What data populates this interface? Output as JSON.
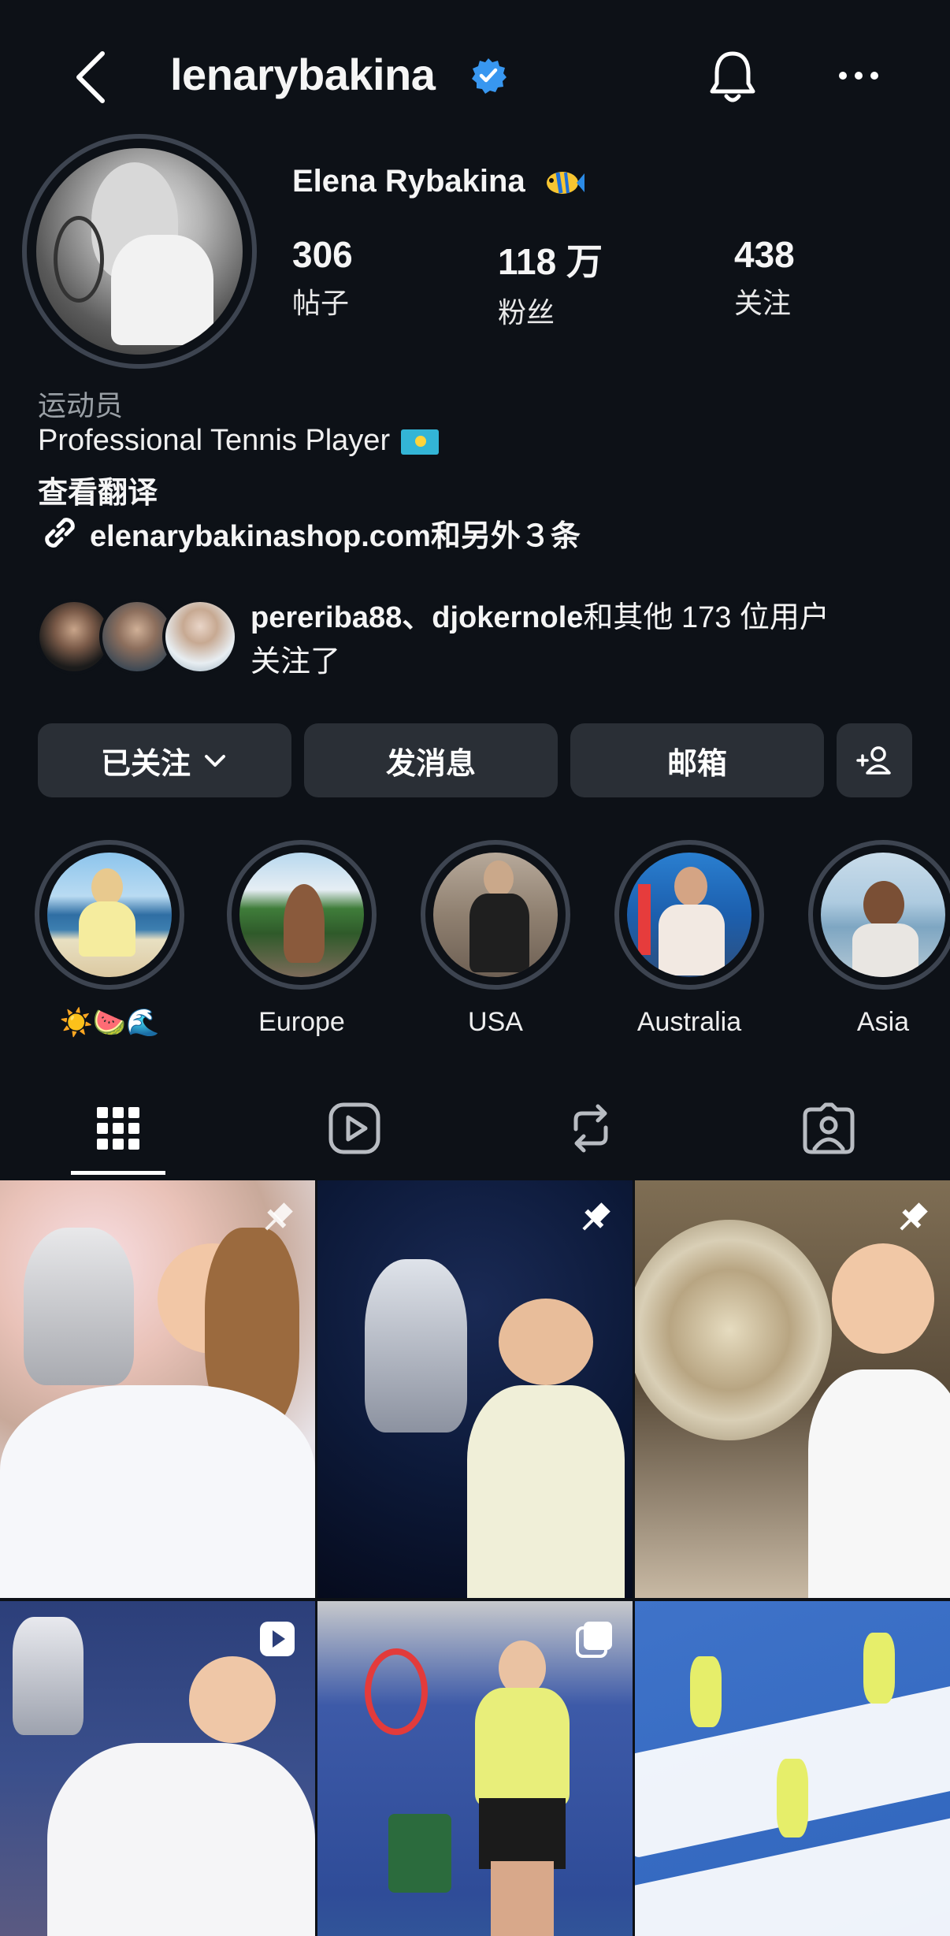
{
  "header": {
    "username": "lenarybakina"
  },
  "profile": {
    "full_name": "Elena Rybakina",
    "stats": [
      {
        "value": "306",
        "label": "帖子"
      },
      {
        "value": "118 万",
        "label": "粉丝"
      },
      {
        "value": "438",
        "label": "关注"
      }
    ],
    "category": "运动员",
    "bio": "Professional Tennis Player",
    "translate_label": "查看翻译",
    "link_text": "elenarybakinashop.com和另外３条"
  },
  "followed_by": {
    "names": "pereriba88、djokernole",
    "rest": "和其他 173 位用户",
    "line2": "关注了"
  },
  "actions": {
    "following_label": "已关注",
    "message_label": "发消息",
    "email_label": "邮箱"
  },
  "highlights": [
    {
      "label": "☀️🍉🌊"
    },
    {
      "label": "Europe"
    },
    {
      "label": "USA"
    },
    {
      "label": "Australia"
    },
    {
      "label": "Asia"
    }
  ],
  "tabs": [
    {
      "icon": "grid-icon",
      "active": true
    },
    {
      "icon": "reels-icon",
      "active": false
    },
    {
      "icon": "reposts-icon",
      "active": false
    },
    {
      "icon": "tagged-icon",
      "active": false
    }
  ],
  "colors": {
    "background": "#0d1117",
    "button": "#2a2f36",
    "verified": "#3897f0",
    "ring": "#3d4450"
  }
}
